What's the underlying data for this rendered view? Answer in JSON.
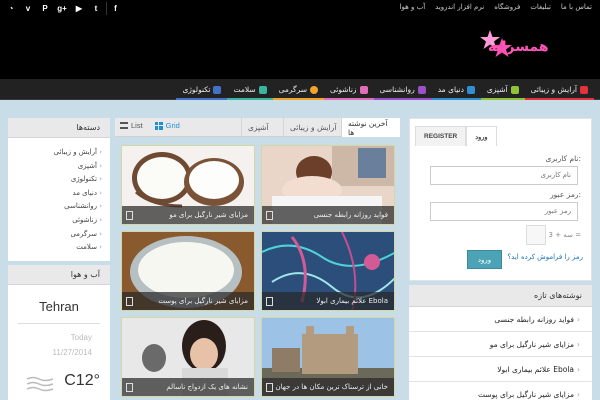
{
  "topbar": {
    "social": [
      {
        "icon": "rss-icon",
        "glyph": "◔"
      },
      {
        "icon": "vimeo-icon",
        "glyph": "v"
      },
      {
        "icon": "pinterest-icon",
        "glyph": "P"
      },
      {
        "icon": "google-plus-icon",
        "glyph": "g+"
      },
      {
        "icon": "youtube-icon",
        "glyph": "▶"
      },
      {
        "icon": "twitter-icon",
        "glyph": "t"
      },
      {
        "icon": "facebook-icon",
        "glyph": "f"
      }
    ],
    "links": [
      "تماس با ما",
      "تبلیغات",
      "فروشگاه",
      "نرم افزار اندروید",
      "آب و هوا"
    ]
  },
  "logo": {
    "text": "همسرانه"
  },
  "nav": {
    "items": [
      {
        "label": "آرایش و زیبائی",
        "color": "#e3323c",
        "icon": "lipstick-icon"
      },
      {
        "label": "آشپزی",
        "color": "#8fc43a",
        "icon": "pot-icon"
      },
      {
        "label": "دنیای مد",
        "color": "#2f8fd0",
        "icon": "dress-icon"
      },
      {
        "label": "روانشناسی",
        "color": "#9a50c8",
        "icon": "brain-icon"
      },
      {
        "label": "زناشوئی",
        "color": "#e36cb8",
        "icon": "rings-icon"
      },
      {
        "label": "سرگرمی",
        "color": "#f1a32a",
        "icon": "smiley-icon"
      },
      {
        "label": "سلامت",
        "color": "#39b5a0",
        "icon": "health-icon"
      },
      {
        "label": "تکنولوژی",
        "color": "#4470c8",
        "icon": "monitor-icon"
      }
    ]
  },
  "categories": {
    "title": "دسته‌ها",
    "items": [
      "آرایش و زیبائی",
      "آشپزی",
      "تکنولوژی",
      "دنیای مد",
      "روانشناسی",
      "زناشوئی",
      "سرگرمی",
      "سلامت"
    ]
  },
  "weather": {
    "title": "آب و هوا",
    "city": "Tehran",
    "today": "Today",
    "date": "11/27/2014",
    "temp": "C12°"
  },
  "tabs": {
    "items": [
      "آخرین نوشته ها",
      "آرایش و زیبائی",
      "آشپزی"
    ],
    "grid_label": "Grid",
    "list_label": "List"
  },
  "cards": [
    {
      "caption": "فواید روزانه رابطه جنسی"
    },
    {
      "caption": "مزایای شیر نارگیل برای مو"
    },
    {
      "caption": "علائم بیماری ابولا Ebola"
    },
    {
      "caption": "مزایای شیر نارگیل برای پوست"
    },
    {
      "caption": "خانی از ترسناک ترین مکان ها در جهان"
    },
    {
      "caption": "نشانه های یک ازدواج ناسالم"
    }
  ],
  "login": {
    "tab_login": "ورود",
    "tab_register": "REGISTER",
    "username_label": "نام کاربری:",
    "username_placeholder": "نام کاربری",
    "password_label": "رمز عبور:",
    "password_placeholder": "رمز عبور",
    "captcha_question": "3 + سه =",
    "forgot": "رمز را فراموش کرده اید؟",
    "submit": "ورود"
  },
  "newposts": {
    "title": "نوشته‌های تازه",
    "items": [
      "فواید روزانه رابطه جنسی",
      "مزایای شیر نارگیل برای مو",
      "علائم بیماری ابولا Ebola",
      "مزایای شیر نارگیل برای پوست"
    ]
  }
}
